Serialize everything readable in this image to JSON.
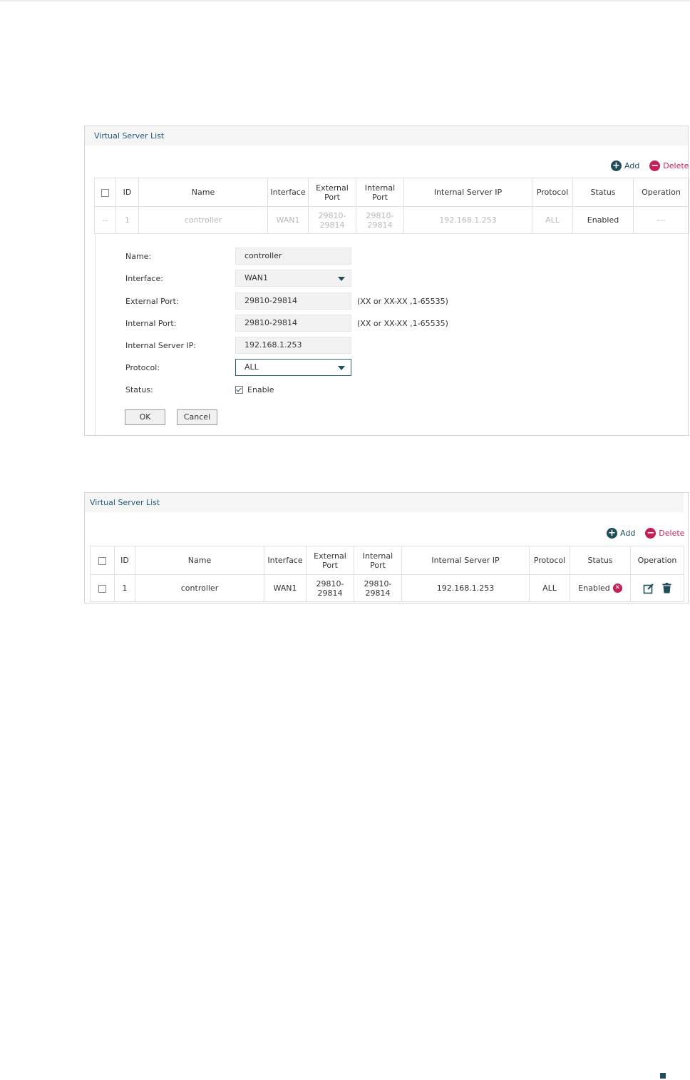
{
  "panel1": {
    "title": "Virtual Server List",
    "add_label": "Add",
    "delete_label": "Delete",
    "headers": [
      "ID",
      "Name",
      "Interface",
      "External Port",
      "Internal Port",
      "Internal Server IP",
      "Protocol",
      "Status",
      "Operation"
    ],
    "row": {
      "select": "--",
      "id": "1",
      "name": "controller",
      "interface": "WAN1",
      "external_port": "29810-29814",
      "internal_port": "29810-29814",
      "server_ip": "192.168.1.253",
      "protocol": "ALL",
      "status": "Enabled",
      "operation": "---"
    },
    "form": {
      "name_label": "Name:",
      "name_value": "controller",
      "interface_label": "Interface:",
      "interface_value": "WAN1",
      "external_port_label": "External Port:",
      "external_port_value": "29810-29814",
      "external_port_hint": "(XX or XX-XX ,1-65535)",
      "internal_port_label": "Internal Port:",
      "internal_port_value": "29810-29814",
      "internal_port_hint": "(XX or XX-XX ,1-65535)",
      "server_ip_label": "Internal Server IP:",
      "server_ip_value": "192.168.1.253",
      "protocol_label": "Protocol:",
      "protocol_value": "ALL",
      "status_label": "Status:",
      "status_enable_label": "Enable",
      "status_enabled": true,
      "ok_label": "OK",
      "cancel_label": "Cancel"
    }
  },
  "panel2": {
    "title": "Virtual Server List",
    "add_label": "Add",
    "delete_label": "Delete",
    "headers": [
      "ID",
      "Name",
      "Interface",
      "External Port",
      "Internal Port",
      "Internal Server IP",
      "Protocol",
      "Status",
      "Operation"
    ],
    "row": {
      "id": "1",
      "name": "controller",
      "interface": "WAN1",
      "external_port": "29810-29814",
      "internal_port": "29810-29814",
      "server_ip": "192.168.1.253",
      "protocol": "ALL",
      "status": "Enabled"
    }
  },
  "colors": {
    "accent": "#1e4e5a",
    "delete": "#c3205b",
    "title_text": "#1f5d7a"
  },
  "icons": [
    "plus-circle-icon",
    "minus-circle-icon",
    "checkbox-icon",
    "dropdown-caret-icon",
    "disable-x-icon",
    "edit-icon",
    "trash-icon"
  ]
}
